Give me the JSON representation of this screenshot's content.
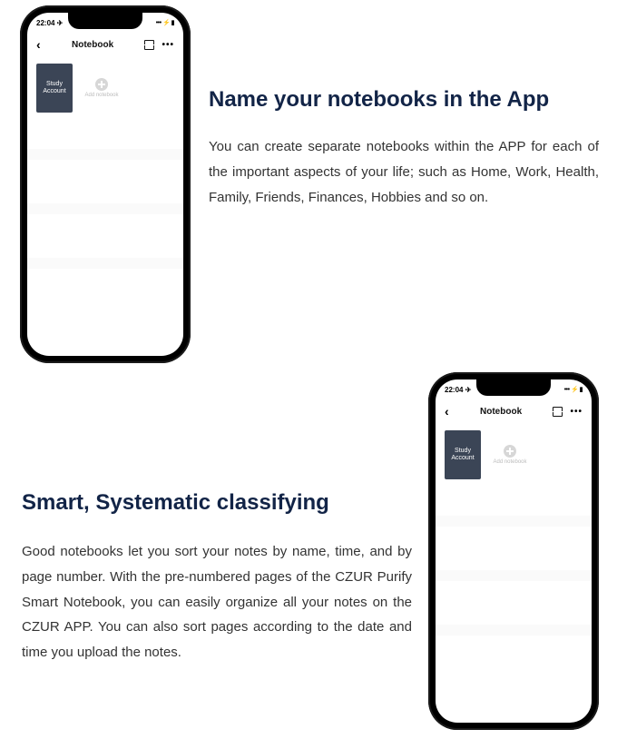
{
  "phone": {
    "status_time": "22:04",
    "status_time_suffix": "✈",
    "status_right": "••• ⚡ ▮",
    "header_title": "Notebook",
    "notebook_label": "Study Account",
    "add_label": "Add notebook"
  },
  "section1": {
    "heading": "Name your notebooks in the App",
    "body": "You can create separate notebooks within the APP for each of the important aspects of your life; such as Home, Work, Health, Family, Friends, Finances, Hobbies and so on."
  },
  "section2": {
    "heading": "Smart, Systematic classifying",
    "body": "Good notebooks let you sort your notes by name, time, and by page number. With the pre-numbered pages of the CZUR Purify Smart Notebook, you can easily organize all your notes on the CZUR APP. You can also sort pages according to the date and time you upload the notes."
  }
}
